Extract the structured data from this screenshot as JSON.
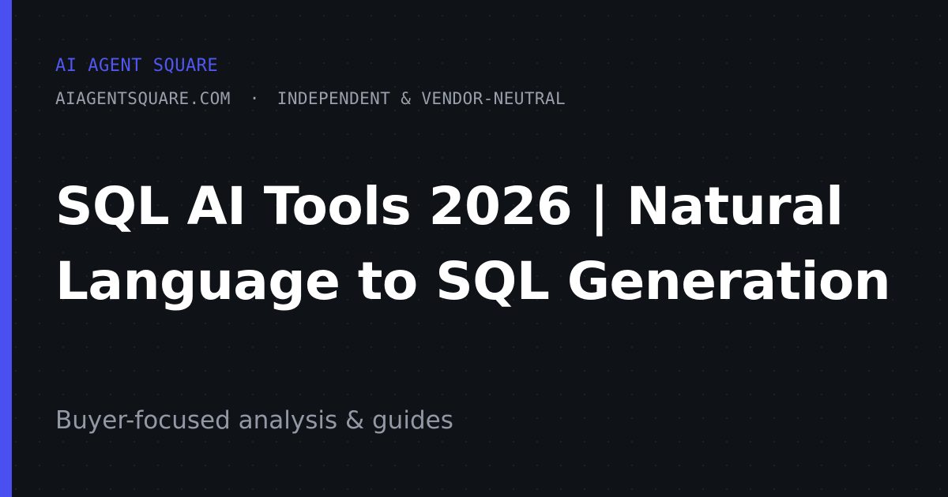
{
  "brand": {
    "name": "AI AGENT SQUARE",
    "domain": "AIAGENTSQUARE.COM",
    "separator": "·",
    "tagline": "INDEPENDENT & VENDOR-NEUTRAL"
  },
  "headline": {
    "title": "SQL AI Tools 2026 | Natural Language to SQL Generation",
    "subtitle": "Buyer-focused analysis & guides"
  },
  "colors": {
    "background": "#0f1217",
    "accent": "#4a4ff0",
    "brand_text": "#5157f2",
    "title_text": "#ffffff",
    "muted_text": "#9aa0ab"
  }
}
